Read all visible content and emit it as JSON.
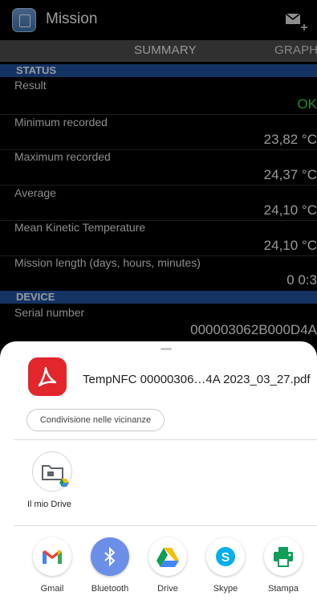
{
  "app_bar": {
    "title": "Mission"
  },
  "tabs": [
    {
      "label": "SUMMARY"
    },
    {
      "label": "GRAPH"
    }
  ],
  "status": {
    "header": "STATUS",
    "rows": [
      {
        "label": "Result",
        "value": "OK"
      },
      {
        "label": "Minimum recorded",
        "value": "23,82 °C"
      },
      {
        "label": "Maximum recorded",
        "value": "24,37 °C"
      },
      {
        "label": "Average",
        "value": "24,10 °C"
      },
      {
        "label": "Mean Kinetic Temperature",
        "value": "24,10 °C"
      },
      {
        "label": "Mission length (days, hours, minutes)",
        "value": "0 0:3"
      }
    ]
  },
  "device": {
    "header": "DEVICE",
    "rows": [
      {
        "label": "Serial number",
        "value": "000003062B000D4A"
      }
    ]
  },
  "share_sheet": {
    "file_name": "TempNFC 00000306…4A 2023_03_27.pdf",
    "nearby_share_label": "Condivisione nelle vicinanze",
    "shortcut": {
      "label": "Il mio Drive"
    },
    "apps": [
      {
        "name": "Gmail",
        "icon": "gmail-icon"
      },
      {
        "name": "Bluetooth",
        "icon": "bluetooth-icon"
      },
      {
        "name": "Drive",
        "icon": "google-drive-icon"
      },
      {
        "name": "Skype",
        "icon": "skype-icon"
      },
      {
        "name": "Stampa",
        "icon": "printer-icon"
      }
    ]
  },
  "colors": {
    "section_header": "#1f4f99",
    "ok": "#35d84a",
    "pdf_red": "#e1262c",
    "bluetooth_blue": "#6b8fe8",
    "print_green": "#0f9d58",
    "skype_blue": "#00aff0"
  }
}
